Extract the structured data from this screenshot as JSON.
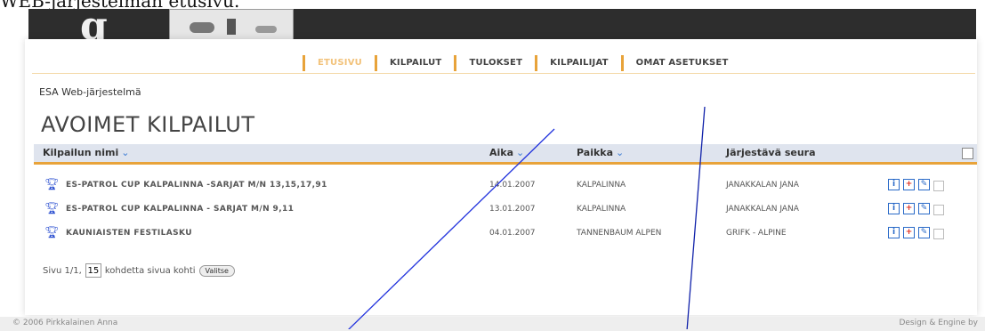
{
  "caption": "WEB-järjestelmän etusivu.",
  "header": {
    "logo_letter": "g"
  },
  "nav": {
    "items": [
      {
        "label": "ETUSIVU",
        "active": true
      },
      {
        "label": "KILPAILUT",
        "active": false
      },
      {
        "label": "TULOKSET",
        "active": false
      },
      {
        "label": "KILPAILIJAT",
        "active": false
      },
      {
        "label": "OMAT ASETUKSET",
        "active": false
      }
    ]
  },
  "breadcrumb": "ESA Web-järjestelmä",
  "page_title": "AVOIMET KILPAILUT",
  "table": {
    "columns": {
      "name": "Kilpailun nimi",
      "date": "Aika",
      "place": "Paikka",
      "club": "Järjestävä seura"
    },
    "sort_icon": "⌄",
    "rows": [
      {
        "name": "ES-PATROL CUP KALPALINNA -SARJAT M/N 13,15,17,91",
        "date": "14.01.2007",
        "place": "KALPALINNA",
        "club": "JANAKKALAN JANA"
      },
      {
        "name": "ES-PATROL CUP KALPALINNA - SARJAT M/N 9,11",
        "date": "13.01.2007",
        "place": "KALPALINNA",
        "club": "JANAKKALAN JANA"
      },
      {
        "name": "KAUNIAISTEN FESTILASKU",
        "date": "04.01.2007",
        "place": "TANNENBAUM ALPEN",
        "club": "GRIFK - ALPINE"
      }
    ],
    "actions": {
      "info": "i",
      "add": "+",
      "edit": "✎"
    }
  },
  "pager": {
    "prefix": "Sivu 1/1,",
    "per_page": "15",
    "suffix": "kohdetta sivua kohti",
    "button": "Valitse"
  },
  "footer": {
    "left": "© 2006 Pirkkalainen Anna",
    "right": "Design & Engine by"
  },
  "colors": {
    "accent": "#e8a33a",
    "header_bg": "#2d2d2d",
    "table_head_bg": "#dfe4ee",
    "annotation_line": "#2233dd"
  }
}
